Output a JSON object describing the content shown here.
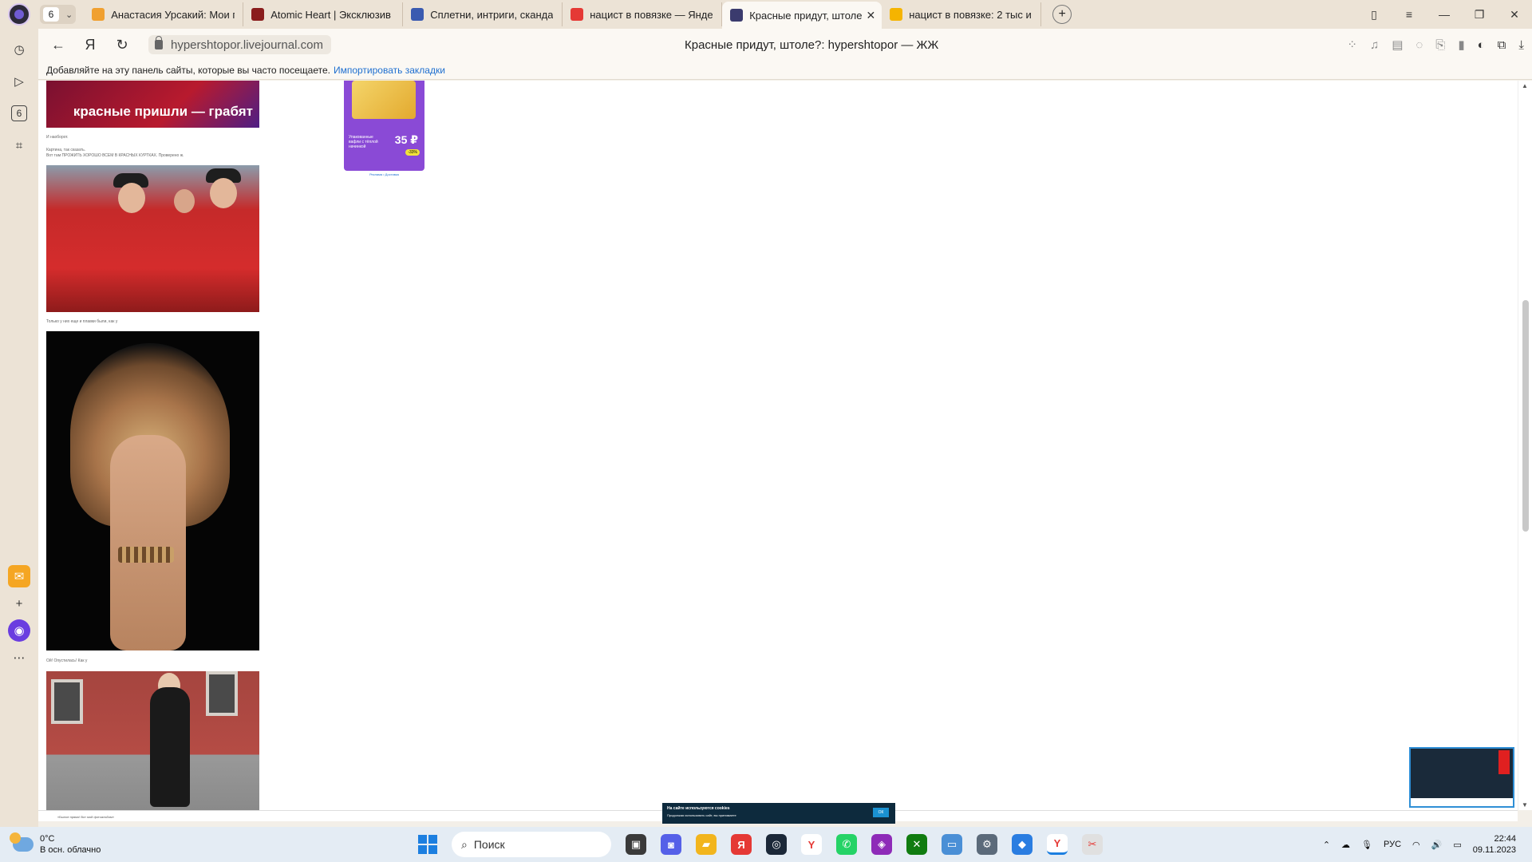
{
  "browser": {
    "tab_count": "6",
    "tabs": [
      {
        "title": "Анастасия Урсакий: Мои г",
        "fav_color": "#f0a030"
      },
      {
        "title": "Atomic Heart | Эксклюзив",
        "fav_color": "#8a1d1d"
      },
      {
        "title": "Сплетни, интриги, сканда",
        "fav_color": "#3a5ab0"
      },
      {
        "title": "нацист в повязке — Янде",
        "fav_color": "#e53935"
      },
      {
        "title": "Красные придут, штоле",
        "fav_color": "#3b3b6e",
        "active": true
      },
      {
        "title": "нацист в повязке: 2 тыс и",
        "fav_color": "#f5b400"
      }
    ],
    "url": "hypershtopor.livejournal.com",
    "page_title": "Красные придут, штоле?: hypershtopor — ЖЖ",
    "bookmarks_prompt": "Добавляйте на эту панель сайты, которые вы часто посещаете.",
    "bookmarks_import": "Импортировать закладки",
    "sidebar_badge": "6"
  },
  "content": {
    "banner_caption": "красные пришли — грабят",
    "text1": "И наоборот.",
    "text2": "Картина, так сказать.",
    "text3": "Вот там ПРОЖИТЬ ХОРОШО ВСЕМ В КРАСНЫХ КУРТКАХ. Проверено ж.",
    "text4": "Только у них еще и плавки были, как у",
    "text5": "Ой! Опустилась! Как у",
    "ad_price": "35 ₽",
    "ad_text": "Упакованные вафли с тёплой начинкой",
    "ad_sale": "-33%",
    "ad_caption": "Реклама • Доставка"
  },
  "cookie": {
    "title": "На сайте используются cookies",
    "text": "Продолжая использовать сайт, вы принимаете",
    "ok": "ОК"
  },
  "footer": {
    "left": "«Былое прямо! Вот мой фотоальбом»"
  },
  "taskbar": {
    "temp": "0°C",
    "weather": "В осн. облачно",
    "search": "Поиск",
    "lang": "РУС",
    "time": "22:44",
    "date": "09.11.2023"
  }
}
